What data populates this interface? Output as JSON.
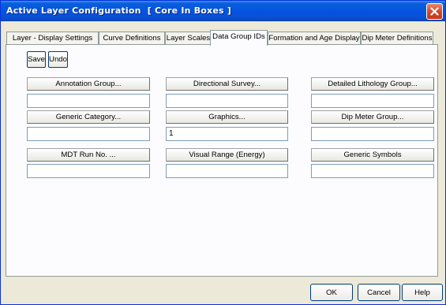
{
  "window": {
    "title": "Active Layer Configuration  [ Core In Boxes ]"
  },
  "tabs": [
    {
      "label": "Layer - Display Settings",
      "active": false
    },
    {
      "label": "Curve Definitions",
      "active": false
    },
    {
      "label": "Layer Scales",
      "active": false
    },
    {
      "label": "Data Group IDs",
      "active": true
    },
    {
      "label": "Formation and Age Display",
      "active": false
    },
    {
      "label": "Dip Meter Definitions",
      "active": false
    }
  ],
  "toolbar": {
    "save_label": "Save",
    "undo_label": "Undo"
  },
  "groups": [
    {
      "label": "Annotation Group...",
      "value": ""
    },
    {
      "label": "Directional Survey...",
      "value": ""
    },
    {
      "label": "Detailed Lithology Group...",
      "value": ""
    },
    {
      "label": "Generic Category...",
      "value": ""
    },
    {
      "label": "Graphics...",
      "value": "1"
    },
    {
      "label": "Dip Meter Group...",
      "value": ""
    },
    {
      "label": "MDT Run No. ...",
      "value": ""
    },
    {
      "label": "Visual Range (Energy)",
      "value": ""
    },
    {
      "label": "Generic Symbols",
      "value": ""
    }
  ],
  "footer": {
    "ok_label": "OK",
    "cancel_label": "Cancel",
    "help_label": "Help"
  },
  "colors": {
    "titlebar": "#0553e3",
    "close": "#d6492c",
    "face": "#ece9d8"
  }
}
